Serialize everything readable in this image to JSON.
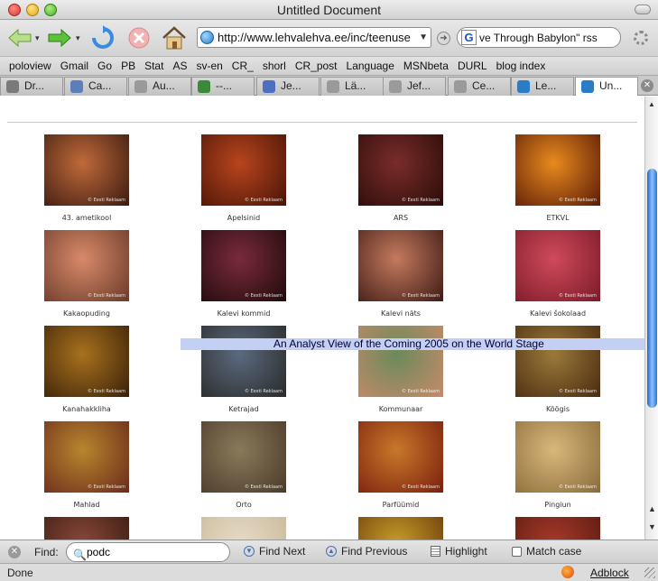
{
  "window": {
    "title": "Untitled Document"
  },
  "toolbar": {
    "back_icon": "back-arrow-icon",
    "forward_icon": "forward-arrow-icon",
    "reload_icon": "reload-icon",
    "stop_icon": "stop-icon",
    "home_icon": "home-icon",
    "url": "http://www.lehvalehva.ee/inc/teenuse",
    "search_text": "ve Through Babylon\" rss",
    "search_engine_icon": "G"
  },
  "bookmarks": [
    "poloview",
    "Gmail",
    "Go",
    "PB",
    "Stat",
    "AS",
    "sv-en",
    "CR_",
    "shorl",
    "CR_post",
    "Language",
    "MSNbeta",
    "DURL",
    "blog index"
  ],
  "tabs": [
    {
      "label": "Dr...",
      "color": "#7a7a7a"
    },
    {
      "label": "Ca...",
      "color": "#5b7fb8"
    },
    {
      "label": "Au...",
      "color": "#9a9a9a"
    },
    {
      "label": "--...",
      "color": "#3a8a3a"
    },
    {
      "label": "Je...",
      "color": "#4c6fc0"
    },
    {
      "label": "Lä...",
      "color": "#9a9a9a"
    },
    {
      "label": "Jef...",
      "color": "#9a9a9a"
    },
    {
      "label": "Ce...",
      "color": "#9a9a9a"
    },
    {
      "label": "Le...",
      "color": "#2a7bc8"
    },
    {
      "label": "Un...",
      "color": "#2a7bc8",
      "active": true
    }
  ],
  "thumbnails": [
    {
      "label": "43. ametikool",
      "colors": [
        "#c06a3a",
        "#3a1a10"
      ]
    },
    {
      "label": "Apelsinid",
      "colors": [
        "#b8451c",
        "#4a1408"
      ]
    },
    {
      "label": "ARS",
      "colors": [
        "#7a2c2a",
        "#2a0c08"
      ]
    },
    {
      "label": "ETKVL",
      "colors": [
        "#e88a1e",
        "#5a1a06"
      ]
    },
    {
      "label": "Kakaopuding",
      "colors": [
        "#d88a6a",
        "#6a3a28"
      ]
    },
    {
      "label": "Kalevi kommid",
      "colors": [
        "#7a2a3a",
        "#1e0a0c"
      ]
    },
    {
      "label": "Kalevi näts",
      "colors": [
        "#c47a5e",
        "#3e1a14"
      ]
    },
    {
      "label": "Kalevi šokolaad",
      "colors": [
        "#d04a5a",
        "#7a1a28"
      ]
    },
    {
      "label": "Kanahakkliha",
      "colors": [
        "#a8721e",
        "#3a2008"
      ]
    },
    {
      "label": "Ketrajad",
      "colors": [
        "#5a6a7e",
        "#2a2a2a"
      ]
    },
    {
      "label": "Kommunaar",
      "colors": [
        "#6a8a5a",
        "#c88a6a"
      ]
    },
    {
      "label": "Köögis",
      "colors": [
        "#9a7a3a",
        "#4a2a10"
      ]
    },
    {
      "label": "Mahlad",
      "colors": [
        "#b8862e",
        "#6a2a1a"
      ]
    },
    {
      "label": "Orto",
      "colors": [
        "#8a7a5a",
        "#4a3a2a"
      ]
    },
    {
      "label": "Parfüümid",
      "colors": [
        "#c8782a",
        "#7a1e0e"
      ]
    },
    {
      "label": "Pingiun",
      "colors": [
        "#d8b87a",
        "#8a6a3a"
      ]
    },
    {
      "label": "",
      "colors": [
        "#8a4a3a",
        "#3a1a10"
      ]
    },
    {
      "label": "",
      "colors": [
        "#e8dcc8",
        "#c8b898"
      ]
    },
    {
      "label": "",
      "colors": [
        "#c8a02a",
        "#6a3a0a"
      ]
    },
    {
      "label": "",
      "colors": [
        "#a83a2a",
        "#5a1a10"
      ]
    }
  ],
  "thumb_watermark": "© Eesti Reklaam",
  "marquee_text": "An Analyst View of the Coming 2005 on the World Stage",
  "findbar": {
    "label": "Find:",
    "query": "podc",
    "find_next": "Find Next",
    "find_previous": "Find Previous",
    "highlight": "Highlight",
    "match_case": "Match case"
  },
  "status": {
    "text": "Done",
    "adblock": "Adblock"
  }
}
